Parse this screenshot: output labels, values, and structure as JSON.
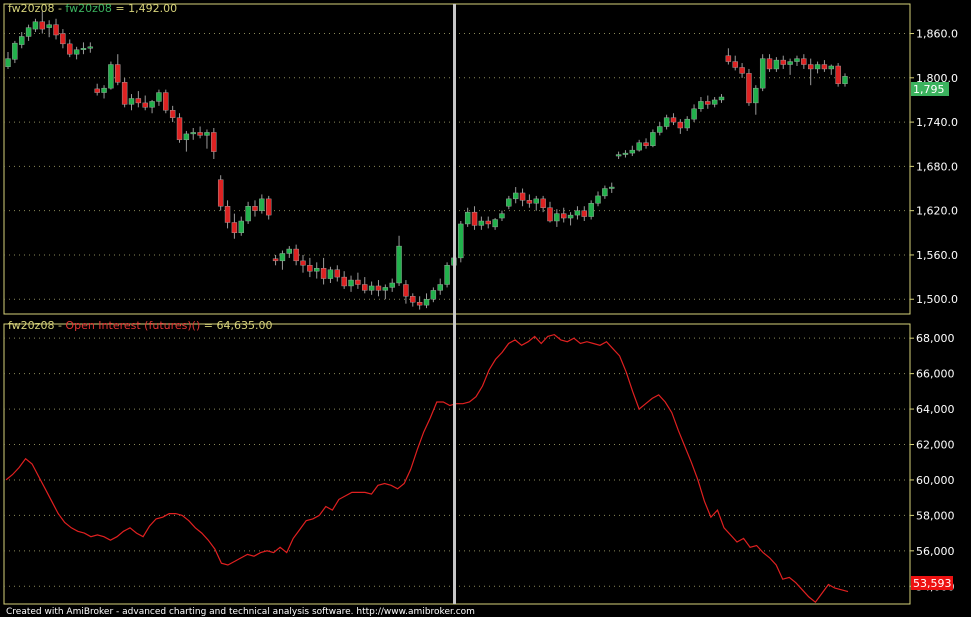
{
  "colors": {
    "background": "#000000",
    "panel_border": "#d6d27a",
    "grid": "#8a8a5a",
    "cursor": "#c8c8c8",
    "candle_up": "#22b14c",
    "candle_down": "#dd2222",
    "oi_line": "#e02020",
    "ticker_text": "#d6d27a",
    "series_text": "#e23535",
    "price_badge": "#3bb25e",
    "oi_badge": "#ee1111"
  },
  "price_panel": {
    "ticker": "fw20z08",
    "separator": " - ",
    "series_name": "fw20z08",
    "value_text": " = 1,492.00",
    "ticks": [
      "1,500.0",
      "1,560.0",
      "1,620.0",
      "1,680.0",
      "1,740.0",
      "1,800.0",
      "1,860.0"
    ],
    "last_badge": "1,795"
  },
  "oi_panel": {
    "ticker": "fw20z08",
    "separator": " - ",
    "series_name": "Open Interest (futures)()",
    "value_text": " = 64,635.00",
    "ticks": [
      "54,000",
      "56,000",
      "58,000",
      "60,000",
      "62,000",
      "64,000",
      "66,000",
      "68,000"
    ],
    "last_badge": "53,593"
  },
  "footer_text": "Created with AmiBroker - advanced charting and technical analysis software. http://www.amibroker.com",
  "chart_data": [
    {
      "type": "candlestick",
      "title": "fw20z08 - fw20z08 = 1,492.00",
      "ylim": [
        1480,
        1900
      ],
      "candles": [
        [
          1815,
          1835,
          1812,
          1826
        ],
        [
          1825,
          1850,
          1820,
          1847
        ],
        [
          1845,
          1862,
          1840,
          1856
        ],
        [
          1856,
          1872,
          1850,
          1868
        ],
        [
          1866,
          1880,
          1862,
          1876
        ],
        [
          1876,
          1890,
          1860,
          1866
        ],
        [
          1868,
          1878,
          1855,
          1872
        ],
        [
          1872,
          1880,
          1852,
          1858
        ],
        [
          1860,
          1866,
          1840,
          1846
        ],
        [
          1846,
          1852,
          1828,
          1832
        ],
        [
          1832,
          1842,
          1825,
          1838
        ],
        [
          1838,
          1848,
          1832,
          1840
        ],
        [
          1840,
          1848,
          1834,
          1842
        ],
        [
          1785,
          1792,
          1776,
          1780
        ],
        [
          1780,
          1790,
          1772,
          1786
        ],
        [
          1786,
          1822,
          1784,
          1818
        ],
        [
          1818,
          1832,
          1790,
          1794
        ],
        [
          1794,
          1800,
          1760,
          1764
        ],
        [
          1764,
          1778,
          1756,
          1772
        ],
        [
          1772,
          1782,
          1760,
          1766
        ],
        [
          1766,
          1776,
          1756,
          1760
        ],
        [
          1760,
          1770,
          1752,
          1768
        ],
        [
          1768,
          1784,
          1762,
          1780
        ],
        [
          1780,
          1784,
          1752,
          1756
        ],
        [
          1756,
          1762,
          1740,
          1746
        ],
        [
          1746,
          1752,
          1712,
          1716
        ],
        [
          1716,
          1728,
          1700,
          1724
        ],
        [
          1724,
          1732,
          1716,
          1726
        ],
        [
          1726,
          1734,
          1718,
          1722
        ],
        [
          1722,
          1730,
          1704,
          1726
        ],
        [
          1726,
          1732,
          1690,
          1700
        ],
        [
          1662,
          1668,
          1620,
          1626
        ],
        [
          1626,
          1634,
          1596,
          1604
        ],
        [
          1604,
          1616,
          1582,
          1590
        ],
        [
          1590,
          1612,
          1586,
          1606
        ],
        [
          1606,
          1632,
          1602,
          1626
        ],
        [
          1626,
          1634,
          1612,
          1620
        ],
        [
          1620,
          1642,
          1616,
          1636
        ],
        [
          1636,
          1640,
          1608,
          1614
        ],
        [
          1555,
          1560,
          1546,
          1552
        ],
        [
          1552,
          1566,
          1540,
          1562
        ],
        [
          1562,
          1572,
          1556,
          1568
        ],
        [
          1568,
          1574,
          1546,
          1552
        ],
        [
          1552,
          1560,
          1536,
          1546
        ],
        [
          1546,
          1556,
          1530,
          1538
        ],
        [
          1538,
          1550,
          1528,
          1542
        ],
        [
          1542,
          1556,
          1520,
          1528
        ],
        [
          1528,
          1544,
          1522,
          1540
        ],
        [
          1540,
          1546,
          1524,
          1530
        ],
        [
          1530,
          1538,
          1514,
          1518
        ],
        [
          1518,
          1532,
          1510,
          1526
        ],
        [
          1526,
          1536,
          1514,
          1520
        ],
        [
          1520,
          1530,
          1508,
          1512
        ],
        [
          1512,
          1524,
          1506,
          1518
        ],
        [
          1518,
          1526,
          1504,
          1512
        ],
        [
          1512,
          1520,
          1500,
          1516
        ],
        [
          1516,
          1528,
          1510,
          1522
        ],
        [
          1522,
          1586,
          1518,
          1572
        ],
        [
          1520,
          1526,
          1494,
          1504
        ],
        [
          1504,
          1508,
          1490,
          1496
        ],
        [
          1496,
          1504,
          1486,
          1492
        ],
        [
          1492,
          1508,
          1488,
          1500
        ],
        [
          1500,
          1516,
          1496,
          1512
        ],
        [
          1512,
          1528,
          1506,
          1520
        ],
        [
          1520,
          1550,
          1516,
          1546
        ],
        [
          1546,
          1562,
          1540,
          1556
        ],
        [
          1556,
          1606,
          1550,
          1602
        ],
        [
          1602,
          1624,
          1598,
          1618
        ],
        [
          1618,
          1626,
          1594,
          1600
        ],
        [
          1600,
          1612,
          1594,
          1606
        ],
        [
          1606,
          1612,
          1596,
          1602
        ],
        [
          1598,
          1610,
          1594,
          1608
        ],
        [
          1610,
          1620,
          1606,
          1616
        ],
        [
          1626,
          1640,
          1622,
          1636
        ],
        [
          1636,
          1652,
          1630,
          1644
        ],
        [
          1644,
          1650,
          1626,
          1634
        ],
        [
          1634,
          1642,
          1624,
          1630
        ],
        [
          1630,
          1640,
          1620,
          1636
        ],
        [
          1636,
          1640,
          1618,
          1624
        ],
        [
          1624,
          1632,
          1604,
          1606
        ],
        [
          1606,
          1622,
          1598,
          1616
        ],
        [
          1616,
          1624,
          1604,
          1610
        ],
        [
          1610,
          1618,
          1600,
          1614
        ],
        [
          1614,
          1626,
          1608,
          1620
        ],
        [
          1620,
          1626,
          1606,
          1612
        ],
        [
          1612,
          1634,
          1608,
          1630
        ],
        [
          1630,
          1646,
          1626,
          1640
        ],
        [
          1640,
          1654,
          1636,
          1650
        ],
        [
          1650,
          1658,
          1644,
          1652
        ],
        [
          1694,
          1700,
          1690,
          1696
        ],
        [
          1696,
          1702,
          1692,
          1698
        ],
        [
          1698,
          1708,
          1694,
          1702
        ],
        [
          1702,
          1716,
          1700,
          1712
        ],
        [
          1712,
          1718,
          1704,
          1708
        ],
        [
          1708,
          1730,
          1706,
          1726
        ],
        [
          1726,
          1740,
          1722,
          1734
        ],
        [
          1734,
          1750,
          1730,
          1746
        ],
        [
          1746,
          1752,
          1736,
          1740
        ],
        [
          1740,
          1744,
          1724,
          1732
        ],
        [
          1732,
          1748,
          1728,
          1744
        ],
        [
          1744,
          1764,
          1740,
          1758
        ],
        [
          1758,
          1774,
          1754,
          1768
        ],
        [
          1768,
          1776,
          1758,
          1764
        ],
        [
          1764,
          1774,
          1760,
          1770
        ],
        [
          1770,
          1778,
          1766,
          1774
        ],
        [
          1830,
          1840,
          1818,
          1822
        ],
        [
          1822,
          1830,
          1810,
          1814
        ],
        [
          1814,
          1820,
          1800,
          1806
        ],
        [
          1806,
          1812,
          1762,
          1766
        ],
        [
          1766,
          1790,
          1750,
          1786
        ],
        [
          1786,
          1832,
          1782,
          1826
        ],
        [
          1826,
          1832,
          1808,
          1812
        ],
        [
          1812,
          1828,
          1808,
          1824
        ],
        [
          1824,
          1830,
          1812,
          1818
        ],
        [
          1818,
          1826,
          1804,
          1822
        ],
        [
          1822,
          1830,
          1816,
          1826
        ],
        [
          1826,
          1832,
          1812,
          1818
        ],
        [
          1818,
          1826,
          1790,
          1812
        ],
        [
          1812,
          1822,
          1806,
          1818
        ],
        [
          1818,
          1824,
          1808,
          1812
        ],
        [
          1812,
          1818,
          1804,
          1816
        ],
        [
          1816,
          1820,
          1788,
          1792
        ],
        [
          1792,
          1806,
          1788,
          1802
        ]
      ]
    },
    {
      "type": "line",
      "title": "fw20z08 - Open Interest (futures)() = 64,635.00",
      "ylim": [
        53000,
        68800
      ],
      "series": [
        {
          "name": "Open Interest (futures)()",
          "values": [
            60000,
            60300,
            60700,
            61200,
            60900,
            60200,
            59500,
            58800,
            58100,
            57600,
            57300,
            57100,
            57000,
            56800,
            56900,
            56800,
            56600,
            56800,
            57100,
            57300,
            57000,
            56800,
            57400,
            57800,
            57900,
            58100,
            58100,
            58000,
            57700,
            57300,
            57000,
            56600,
            56100,
            55300,
            55200,
            55400,
            55600,
            55800,
            55700,
            55900,
            56000,
            55900,
            56200,
            55900,
            56700,
            57200,
            57700,
            57800,
            58000,
            58500,
            58300,
            58900,
            59100,
            59300,
            59300,
            59300,
            59200,
            59700,
            59800,
            59700,
            59500,
            59800,
            60600,
            61700,
            62700,
            63500,
            64400,
            64400,
            64200,
            64300,
            64300,
            64400,
            64700,
            65300,
            66200,
            66800,
            67200,
            67700,
            67900,
            67600,
            67800,
            68100,
            67700,
            68100,
            68200,
            67900,
            67800,
            68000,
            67700,
            67800,
            67700,
            67600,
            67800,
            67400,
            67000,
            66100,
            65000,
            64000,
            64300,
            64600,
            64800,
            64400,
            63800,
            62800,
            61900,
            61000,
            60000,
            58800,
            57900,
            58300,
            57300,
            56900,
            56500,
            56700,
            56200,
            56300,
            55900,
            55600,
            55200,
            54400,
            54500,
            54200,
            53800,
            53400,
            53100,
            53600,
            54100,
            53900,
            53800,
            53700
          ]
        }
      ]
    }
  ]
}
